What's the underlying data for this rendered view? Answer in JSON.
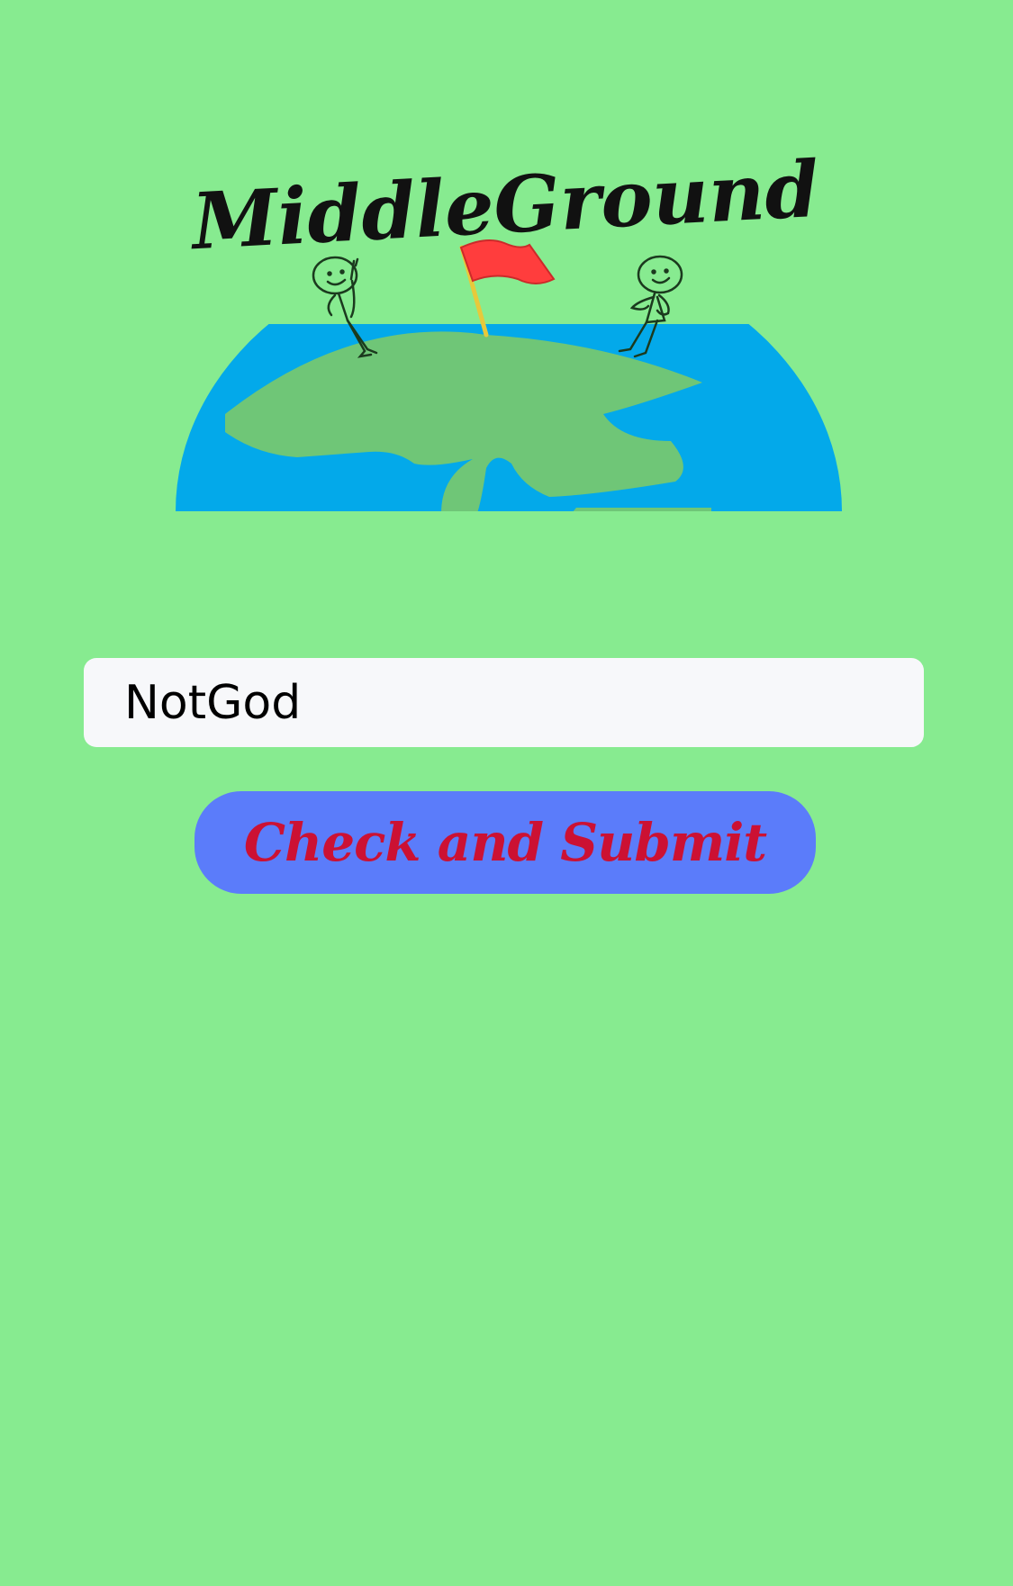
{
  "logo": {
    "text": "MiddleGround",
    "globe_ocean_color": "#03a9ea",
    "globe_land_color": "#6fc677",
    "flag_color": "#ff3d3d",
    "pole_color": "#e7c93b"
  },
  "form": {
    "username_value": "NotGod",
    "submit_label": "Check and Submit"
  },
  "colors": {
    "background": "#87eb90",
    "field_background": "#f7f8fa",
    "button_background": "#5b7cfa",
    "button_text": "#cc1133"
  }
}
